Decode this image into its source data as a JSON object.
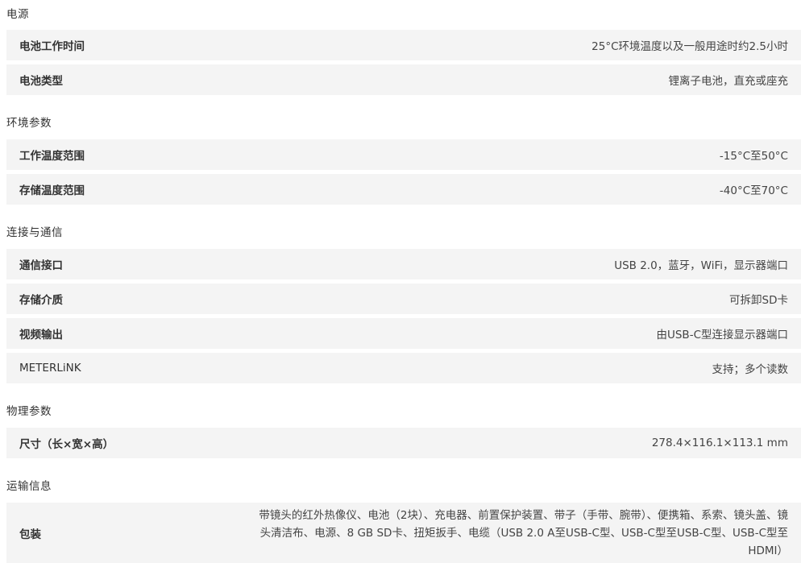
{
  "sections": [
    {
      "title": "电源",
      "rows": [
        {
          "label": "电池工作时间",
          "value": "25°C环境温度以及一般用途时约2.5小时"
        },
        {
          "label": "电池类型",
          "value": "锂离子电池，直充或座充"
        }
      ]
    },
    {
      "title": "环境参数",
      "rows": [
        {
          "label": "工作温度范围",
          "value": "-15°C至50°C"
        },
        {
          "label": "存储温度范围",
          "value": "-40°C至70°C"
        }
      ]
    },
    {
      "title": "连接与通信",
      "rows": [
        {
          "label": "通信接口",
          "value": "USB 2.0，蓝牙，WiFi，显示器端口"
        },
        {
          "label": "存储介质",
          "value": "可拆卸SD卡"
        },
        {
          "label": "视频输出",
          "value": "由USB-C型连接显示器端口"
        },
        {
          "label": "METERLiNK",
          "value": "支持；多个读数"
        }
      ]
    },
    {
      "title": "物理参数",
      "rows": [
        {
          "label": "尺寸（长×宽×高）",
          "value": "278.4×116.1×113.1 mm"
        }
      ]
    },
    {
      "title": "运输信息",
      "rows": [
        {
          "label": "包装",
          "value": "带镜头的红外热像仪、电池（2块）、充电器、前置保护装置、带子（手带、腕带）、便携箱、系索、镜头盖、镜头清洁布、电源、8 GB SD卡、扭矩扳手、电缆（USB 2.0 A至USB-C型、USB-C型至USB-C型、USB-C型至HDMI）"
        }
      ]
    }
  ]
}
